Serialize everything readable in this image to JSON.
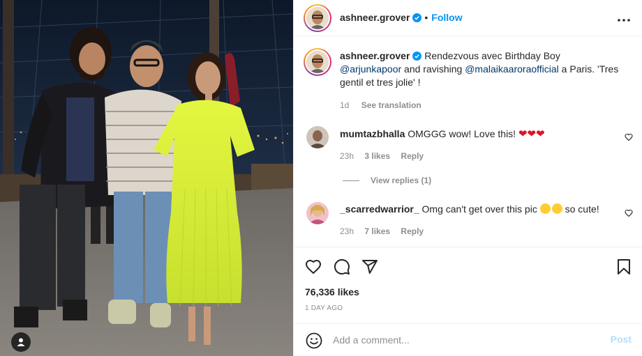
{
  "post": {
    "author": "ashneer.grover",
    "follow_label": "Follow",
    "dot": "•",
    "more_icon": "more-horizontal-icon",
    "caption": {
      "text_before": "Rendezvous avec Birthday Boy ",
      "mention1": "@arjunkapoor",
      "text_middle": " and ravishing ",
      "mention2": "@malaikaaroraofficial",
      "text_after": " a Paris. 'Tres gentil et tres jolie' !",
      "time": "1d",
      "see_translation": "See translation"
    },
    "comments": [
      {
        "user": "mumtazbhalla",
        "text": "OMGGG wow! Love this!",
        "emoji": "❤❤❤",
        "time": "23h",
        "likes": "3 likes",
        "reply_label": "Reply",
        "view_replies": "View replies (1)"
      },
      {
        "user": "_scarredwarrior_",
        "text": "Omg can't get over this pic",
        "text_after": " so cute!",
        "time": "23h",
        "likes": "7 likes",
        "reply_label": "Reply"
      }
    ],
    "likes": "76,336 likes",
    "posted_ago": "1 DAY AGO",
    "add_comment_placeholder": "Add a comment...",
    "post_label": "Post"
  },
  "colors": {
    "accent": "#0095f6",
    "mention": "#00376b",
    "muted": "#8e8e8e",
    "post_disabled": "#b2dffc",
    "heart": "#e0112b",
    "dress": "#d8f23c"
  },
  "icons": [
    "verified-badge-icon",
    "like-icon",
    "comment-icon",
    "share-icon",
    "save-icon",
    "emoji-icon",
    "user-tag-icon",
    "small-heart-icon"
  ]
}
